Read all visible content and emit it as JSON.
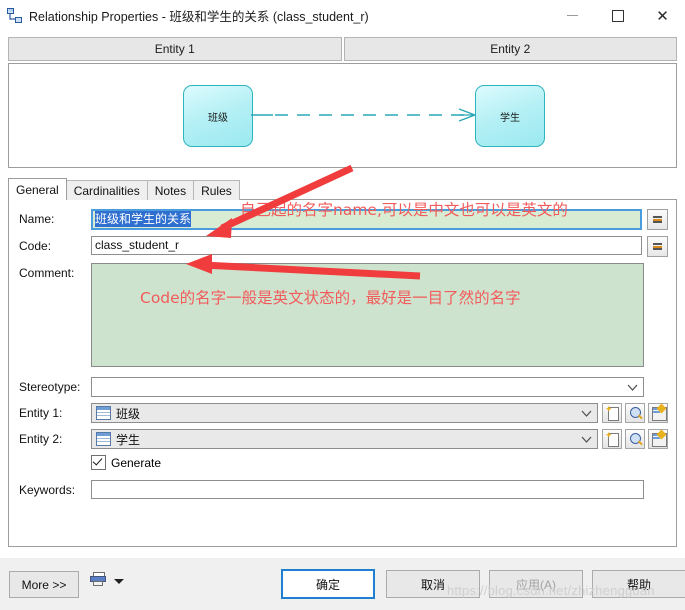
{
  "window": {
    "title": "Relationship Properties - 班级和学生的关系 (class_student_r)",
    "icon": "relationship-icon",
    "minimize_label": "–",
    "maximize_label": "□",
    "close_label": "✕"
  },
  "entity_headers": [
    {
      "label": "Entity 1"
    },
    {
      "label": "Entity 2"
    }
  ],
  "diagram": {
    "left_entity": "班级",
    "right_entity": "学生",
    "line_style": "dashed",
    "cardinality_marker": "crows-foot",
    "line_color": "#29a7b4",
    "box_border_color": "#2fb3bd"
  },
  "tabs": [
    {
      "label": "General",
      "active": true
    },
    {
      "label": "Cardinalities",
      "active": false
    },
    {
      "label": "Notes",
      "active": false
    },
    {
      "label": "Rules",
      "active": false
    }
  ],
  "form": {
    "name": {
      "label": "Name:",
      "value": "班级和学生的关系",
      "selected": true,
      "menu_button": "equals-menu-icon"
    },
    "code": {
      "label": "Code:",
      "value": "class_student_r",
      "menu_button": "equals-menu-icon"
    },
    "comment": {
      "label": "Comment:",
      "value": ""
    },
    "stereotype": {
      "label": "Stereotype:",
      "value": "",
      "chevron": "chevron-down-icon"
    },
    "entity1": {
      "label": "Entity 1:",
      "value": "班级",
      "chevron": "chevron-down-icon",
      "buttons": [
        "new-icon",
        "find-icon",
        "properties-icon"
      ]
    },
    "entity2": {
      "label": "Entity 2:",
      "value": "学生",
      "chevron": "chevron-down-icon",
      "buttons": [
        "new-icon",
        "find-icon",
        "properties-icon"
      ]
    },
    "generate": {
      "label": "Generate",
      "checked": true
    },
    "keywords": {
      "label": "Keywords:",
      "value": ""
    }
  },
  "footer": {
    "more_label": "More >>",
    "print_icon": "print-icon",
    "print_caret": "caret-down-icon",
    "ok_label": "确定",
    "cancel_label": "取消",
    "apply_label": "应用(A)",
    "help_label": "帮助"
  },
  "annotations": {
    "name_note": "自己起的名字name,可以是中文也可以是英文的",
    "comment_note": "Code的名字一般是英文状态的，最好是一目了然的名字",
    "arrow_color": "#f03c3c"
  },
  "watermark": "https://blog.csdn.net/zhizhengguan"
}
